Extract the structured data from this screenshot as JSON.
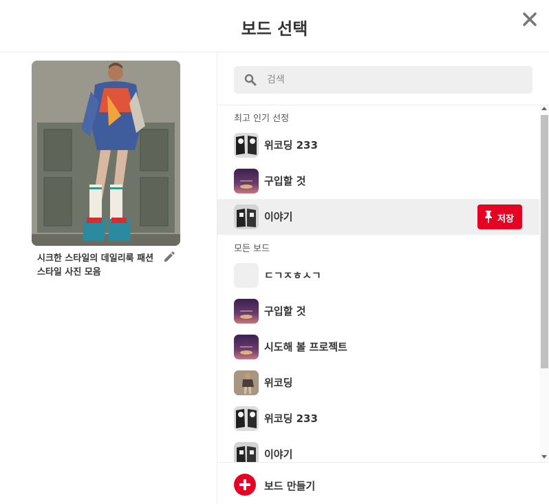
{
  "header": {
    "title": "보드 선택",
    "close_icon": "close-icon"
  },
  "pin": {
    "description": "시크한 스타일의 데일리룩 패션 스타일 사진 모음",
    "edit_icon": "pencil-icon"
  },
  "search": {
    "placeholder": "검색",
    "value": "",
    "icon": "search-icon"
  },
  "sections": {
    "top": "최고 인기 선정",
    "all": "모든 보드"
  },
  "top_boards": [
    {
      "name": "위코딩 233",
      "thumb": "bw-outfit"
    },
    {
      "name": "구입할 것",
      "thumb": "purple-sunset"
    },
    {
      "name": "이야기",
      "thumb": "bw-outfit"
    }
  ],
  "all_boards": [
    {
      "name": "ㄷㄱㅈㅎㅅㄱ",
      "thumb": "empty"
    },
    {
      "name": "구입할 것",
      "thumb": "purple-sunset"
    },
    {
      "name": "시도해 볼 프로젝트",
      "thumb": "purple-sunset"
    },
    {
      "name": "위코딩",
      "thumb": "fashion-photo"
    },
    {
      "name": "위코딩 233",
      "thumb": "bw-outfit"
    },
    {
      "name": "이야기",
      "thumb": "bw-outfit"
    }
  ],
  "save_button": {
    "label": "저장",
    "icon": "pin-icon"
  },
  "create_board": {
    "label": "보드 만들기",
    "icon": "plus-circle-icon"
  },
  "colors": {
    "accent": "#e60023",
    "hover_row": "#efefef",
    "search_bg": "#efefef"
  }
}
